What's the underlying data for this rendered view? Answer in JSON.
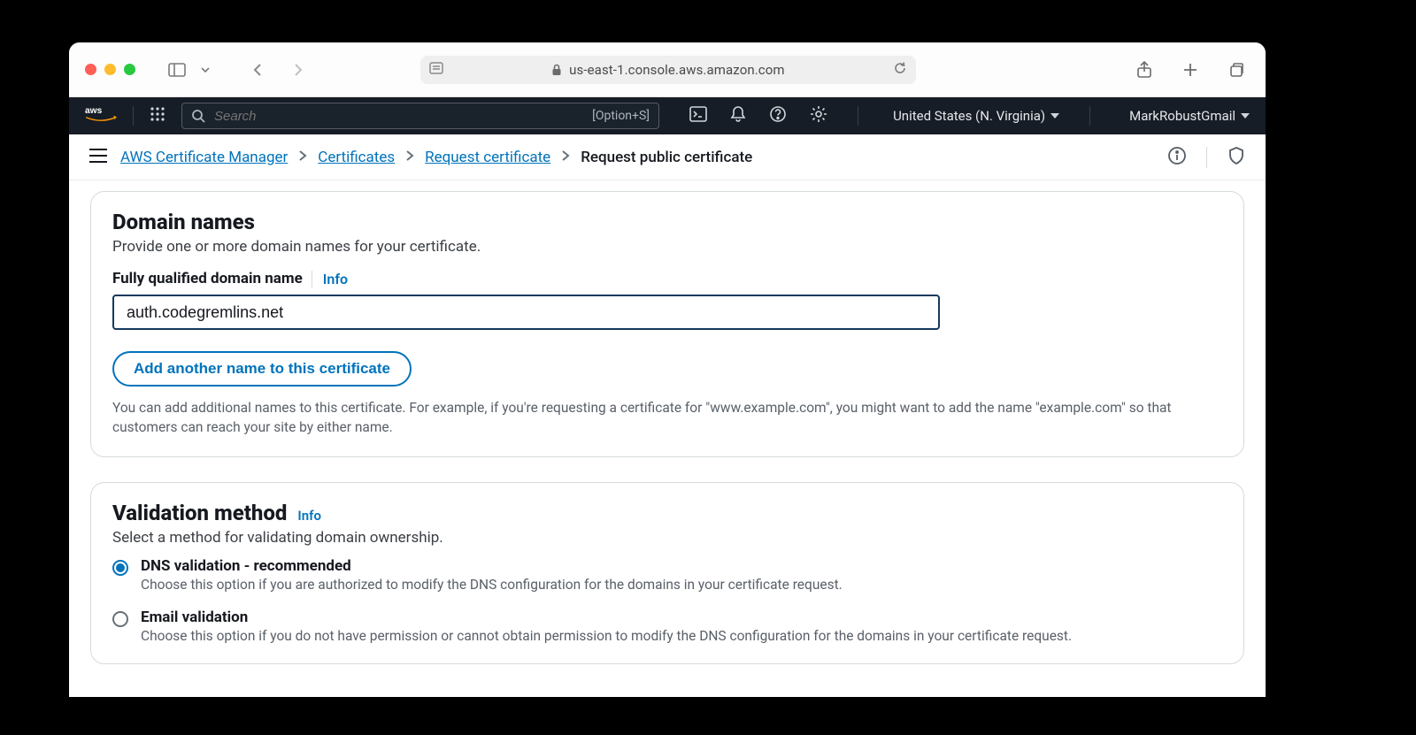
{
  "browser": {
    "url_host": "us-east-1.console.aws.amazon.com"
  },
  "aws_nav": {
    "search_placeholder": "Search",
    "search_shortcut": "[Option+S]",
    "region": "United States (N. Virginia)",
    "user": "MarkRobustGmail"
  },
  "breadcrumbs": {
    "items": [
      "AWS Certificate Manager",
      "Certificates",
      "Request certificate",
      "Request public certificate"
    ]
  },
  "domain_panel": {
    "heading": "Domain names",
    "subtitle": "Provide one or more domain names for your certificate.",
    "field_label": "Fully qualified domain name",
    "info_label": "Info",
    "domain_value": "auth.codegremlins.net",
    "add_button": "Add another name to this certificate",
    "help": "You can add additional names to this certificate. For example, if you're requesting a certificate for \"www.example.com\", you might want to add the name \"example.com\" so that customers can reach your site by either name."
  },
  "validation_panel": {
    "heading": "Validation method",
    "info_label": "Info",
    "subtitle": "Select a method for validating domain ownership.",
    "options": [
      {
        "title": "DNS validation - recommended",
        "desc": "Choose this option if you are authorized to modify the DNS configuration for the domains in your certificate request.",
        "selected": true
      },
      {
        "title": "Email validation",
        "desc": "Choose this option if you do not have permission or cannot obtain permission to modify the DNS configuration for the domains in your certificate request.",
        "selected": false
      }
    ]
  }
}
